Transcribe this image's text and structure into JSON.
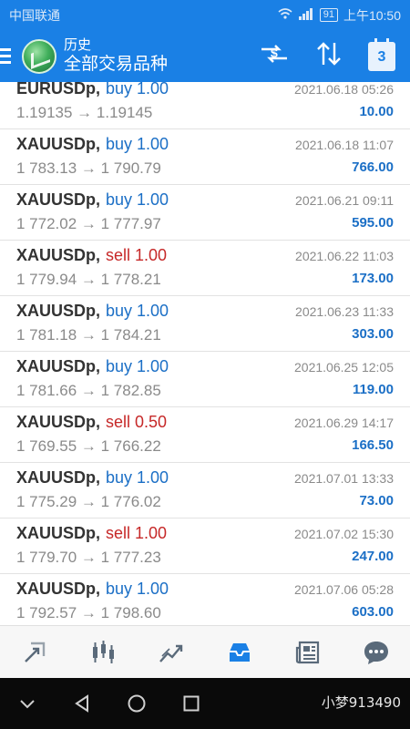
{
  "status_bar": {
    "carrier": "中国联通",
    "battery": "91",
    "time": "上午10:50"
  },
  "app_bar": {
    "title": "历史",
    "subtitle": "全部交易品种",
    "calendar_day": "3"
  },
  "trades": [
    {
      "symbol": "EURUSDp,",
      "side": "buy 1.00",
      "type": "buy",
      "prices": "1.19135 → 1.19145",
      "date": "2021.06.18 05:26",
      "profit": "10.00"
    },
    {
      "symbol": "XAUUSDp,",
      "side": "buy 1.00",
      "type": "buy",
      "prices": "1 783.13 → 1 790.79",
      "date": "2021.06.18 11:07",
      "profit": "766.00"
    },
    {
      "symbol": "XAUUSDp,",
      "side": "buy 1.00",
      "type": "buy",
      "prices": "1 772.02 → 1 777.97",
      "date": "2021.06.21 09:11",
      "profit": "595.00"
    },
    {
      "symbol": "XAUUSDp,",
      "side": "sell 1.00",
      "type": "sell",
      "prices": "1 779.94 → 1 778.21",
      "date": "2021.06.22 11:03",
      "profit": "173.00"
    },
    {
      "symbol": "XAUUSDp,",
      "side": "buy 1.00",
      "type": "buy",
      "prices": "1 781.18 → 1 784.21",
      "date": "2021.06.23 11:33",
      "profit": "303.00"
    },
    {
      "symbol": "XAUUSDp,",
      "side": "buy 1.00",
      "type": "buy",
      "prices": "1 781.66 → 1 782.85",
      "date": "2021.06.25 12:05",
      "profit": "119.00"
    },
    {
      "symbol": "XAUUSDp,",
      "side": "sell 0.50",
      "type": "sell",
      "prices": "1 769.55 → 1 766.22",
      "date": "2021.06.29 14:17",
      "profit": "166.50"
    },
    {
      "symbol": "XAUUSDp,",
      "side": "buy 1.00",
      "type": "buy",
      "prices": "1 775.29 → 1 776.02",
      "date": "2021.07.01 13:33",
      "profit": "73.00"
    },
    {
      "symbol": "XAUUSDp,",
      "side": "sell 1.00",
      "type": "sell",
      "prices": "1 779.70 → 1 777.23",
      "date": "2021.07.02 15:30",
      "profit": "247.00"
    },
    {
      "symbol": "XAUUSDp,",
      "side": "buy 1.00",
      "type": "buy",
      "prices": "1 792.57 → 1 798.60",
      "date": "2021.07.06 05:28",
      "profit": "603.00"
    }
  ],
  "bottom_nav": [
    {
      "icon": "quotes-icon"
    },
    {
      "icon": "chart-icon"
    },
    {
      "icon": "trade-icon"
    },
    {
      "icon": "history-icon",
      "active": true
    },
    {
      "icon": "news-icon"
    },
    {
      "icon": "chat-icon"
    }
  ],
  "watermark": "小梦913490",
  "colors": {
    "accent": "#1a80e5",
    "buy": "#1b6fc6",
    "sell": "#c62828",
    "profit": "#1b6fc6"
  }
}
